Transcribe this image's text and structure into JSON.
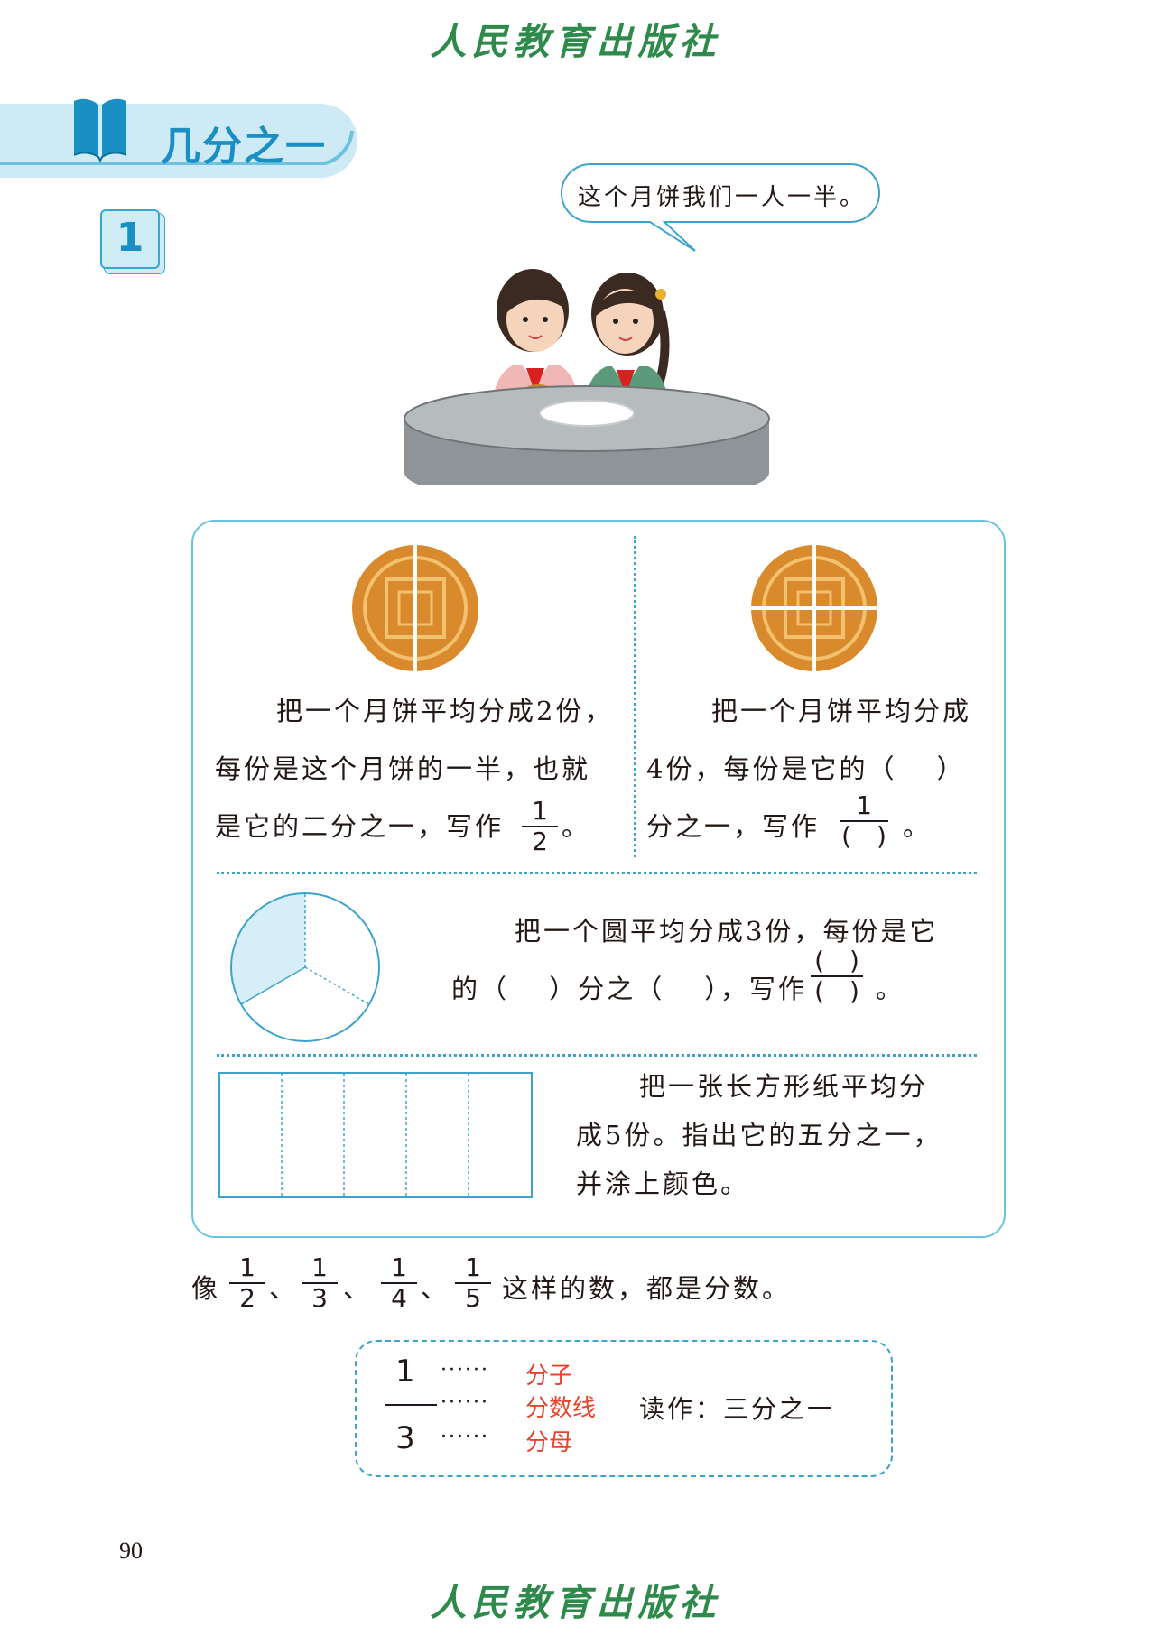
{
  "header": {
    "publisher": "人民教育出版社"
  },
  "footer": {
    "publisher": "人民教育出版社",
    "page_number": "90"
  },
  "section": {
    "title": "几分之一"
  },
  "example": {
    "number": "1"
  },
  "speech_bubble": {
    "text": "这个月饼我们一人一半。"
  },
  "panel": {
    "halves": {
      "line1": "把一个月饼平均分成2份，",
      "line2": "每份是这个月饼的一半，也就",
      "line3": "是它的二分之一，写作",
      "fraction": {
        "numerator": "1",
        "denominator": "2"
      },
      "end": "。"
    },
    "quarters": {
      "line1": "把一个月饼平均分成",
      "line2": "4份，每份是它的（　 ）",
      "line3": "分之一，写作",
      "fraction": {
        "numerator": "1",
        "denominator": "(　)"
      },
      "end": "。"
    },
    "circle": {
      "line1": "把一个圆平均分成3份，每份是它",
      "line2": "的（　 ）分之（　 ），写作",
      "fraction": {
        "numerator": "(　)",
        "denominator": "(　)"
      },
      "end": "。"
    },
    "rectangle": {
      "line1": "把一张长方形纸平均分",
      "line2": "成5份。指出它的五分之一，",
      "line3": "并涂上颜色。"
    }
  },
  "summary": {
    "prefix": "像",
    "fractions": [
      {
        "numerator": "1",
        "denominator": "2"
      },
      {
        "numerator": "1",
        "denominator": "3"
      },
      {
        "numerator": "1",
        "denominator": "4"
      },
      {
        "numerator": "1",
        "denominator": "5"
      }
    ],
    "separator": "、",
    "suffix": "这样的数，都是分数。"
  },
  "terminology": {
    "numerator": "1",
    "denominator": "3",
    "dots": "······",
    "label_numerator": "分子",
    "label_bar": "分数线",
    "label_denominator": "分母",
    "reading": "读作：三分之一"
  },
  "colors": {
    "accent_blue": "#1a8fc4",
    "light_blue": "#d5eef7",
    "publisher_green": "#2e8a4a",
    "term_red": "#e8432d",
    "mooncake": "#d98a2c"
  }
}
